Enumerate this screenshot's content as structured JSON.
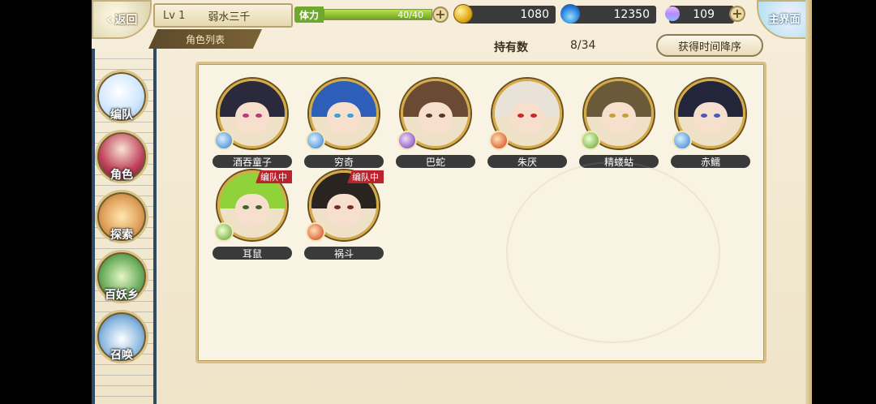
{
  "top_bar": {
    "back_label": "返回",
    "player": {
      "level": "Lv 1",
      "name": "弱水三千"
    },
    "stamina": {
      "label": "体力",
      "value": "40/40",
      "fraction": 1.0
    },
    "coins": "1080",
    "souls": "12350",
    "gems": "109",
    "main_label": "主界面"
  },
  "subheader": {
    "tab_label": "角色列表",
    "count_label": "持有数",
    "count_value": "8/34",
    "sort_label": "获得时间降序"
  },
  "nav": [
    {
      "label": "编队",
      "icon": "formation-icon"
    },
    {
      "label": "角色",
      "icon": "character-icon"
    },
    {
      "label": "探索",
      "icon": "explore-icon"
    },
    {
      "label": "百妖乡",
      "icon": "village-icon"
    },
    {
      "label": "召唤",
      "icon": "summon-icon"
    }
  ],
  "characters": [
    {
      "name": "酒吞童子",
      "element": "water",
      "badge": "",
      "hair": "#2b2a3c",
      "eye": "#b83a7a"
    },
    {
      "name": "穷奇",
      "element": "water",
      "badge": "",
      "hair": "#2e5fb8",
      "eye": "#3aa0d8"
    },
    {
      "name": "巴蛇",
      "element": "dark",
      "badge": "",
      "hair": "#6a4a32",
      "eye": "#5a3a22"
    },
    {
      "name": "朱厌",
      "element": "fire",
      "badge": "",
      "hair": "#e8e2d8",
      "eye": "#c8282a"
    },
    {
      "name": "精蝼蛄",
      "element": "wind",
      "badge": "",
      "hair": "#6b5a3a",
      "eye": "#c2a03a"
    },
    {
      "name": "赤鱬",
      "element": "water",
      "badge": "",
      "hair": "#23263a",
      "eye": "#4a5ab8"
    },
    {
      "name": "耳鼠",
      "element": "wind",
      "badge": "编队中",
      "hair": "#8fd23a",
      "eye": "#3a6a2a"
    },
    {
      "name": "祸斗",
      "element": "fire",
      "badge": "编队中",
      "hair": "#2a2420",
      "eye": "#7a2a22"
    }
  ]
}
